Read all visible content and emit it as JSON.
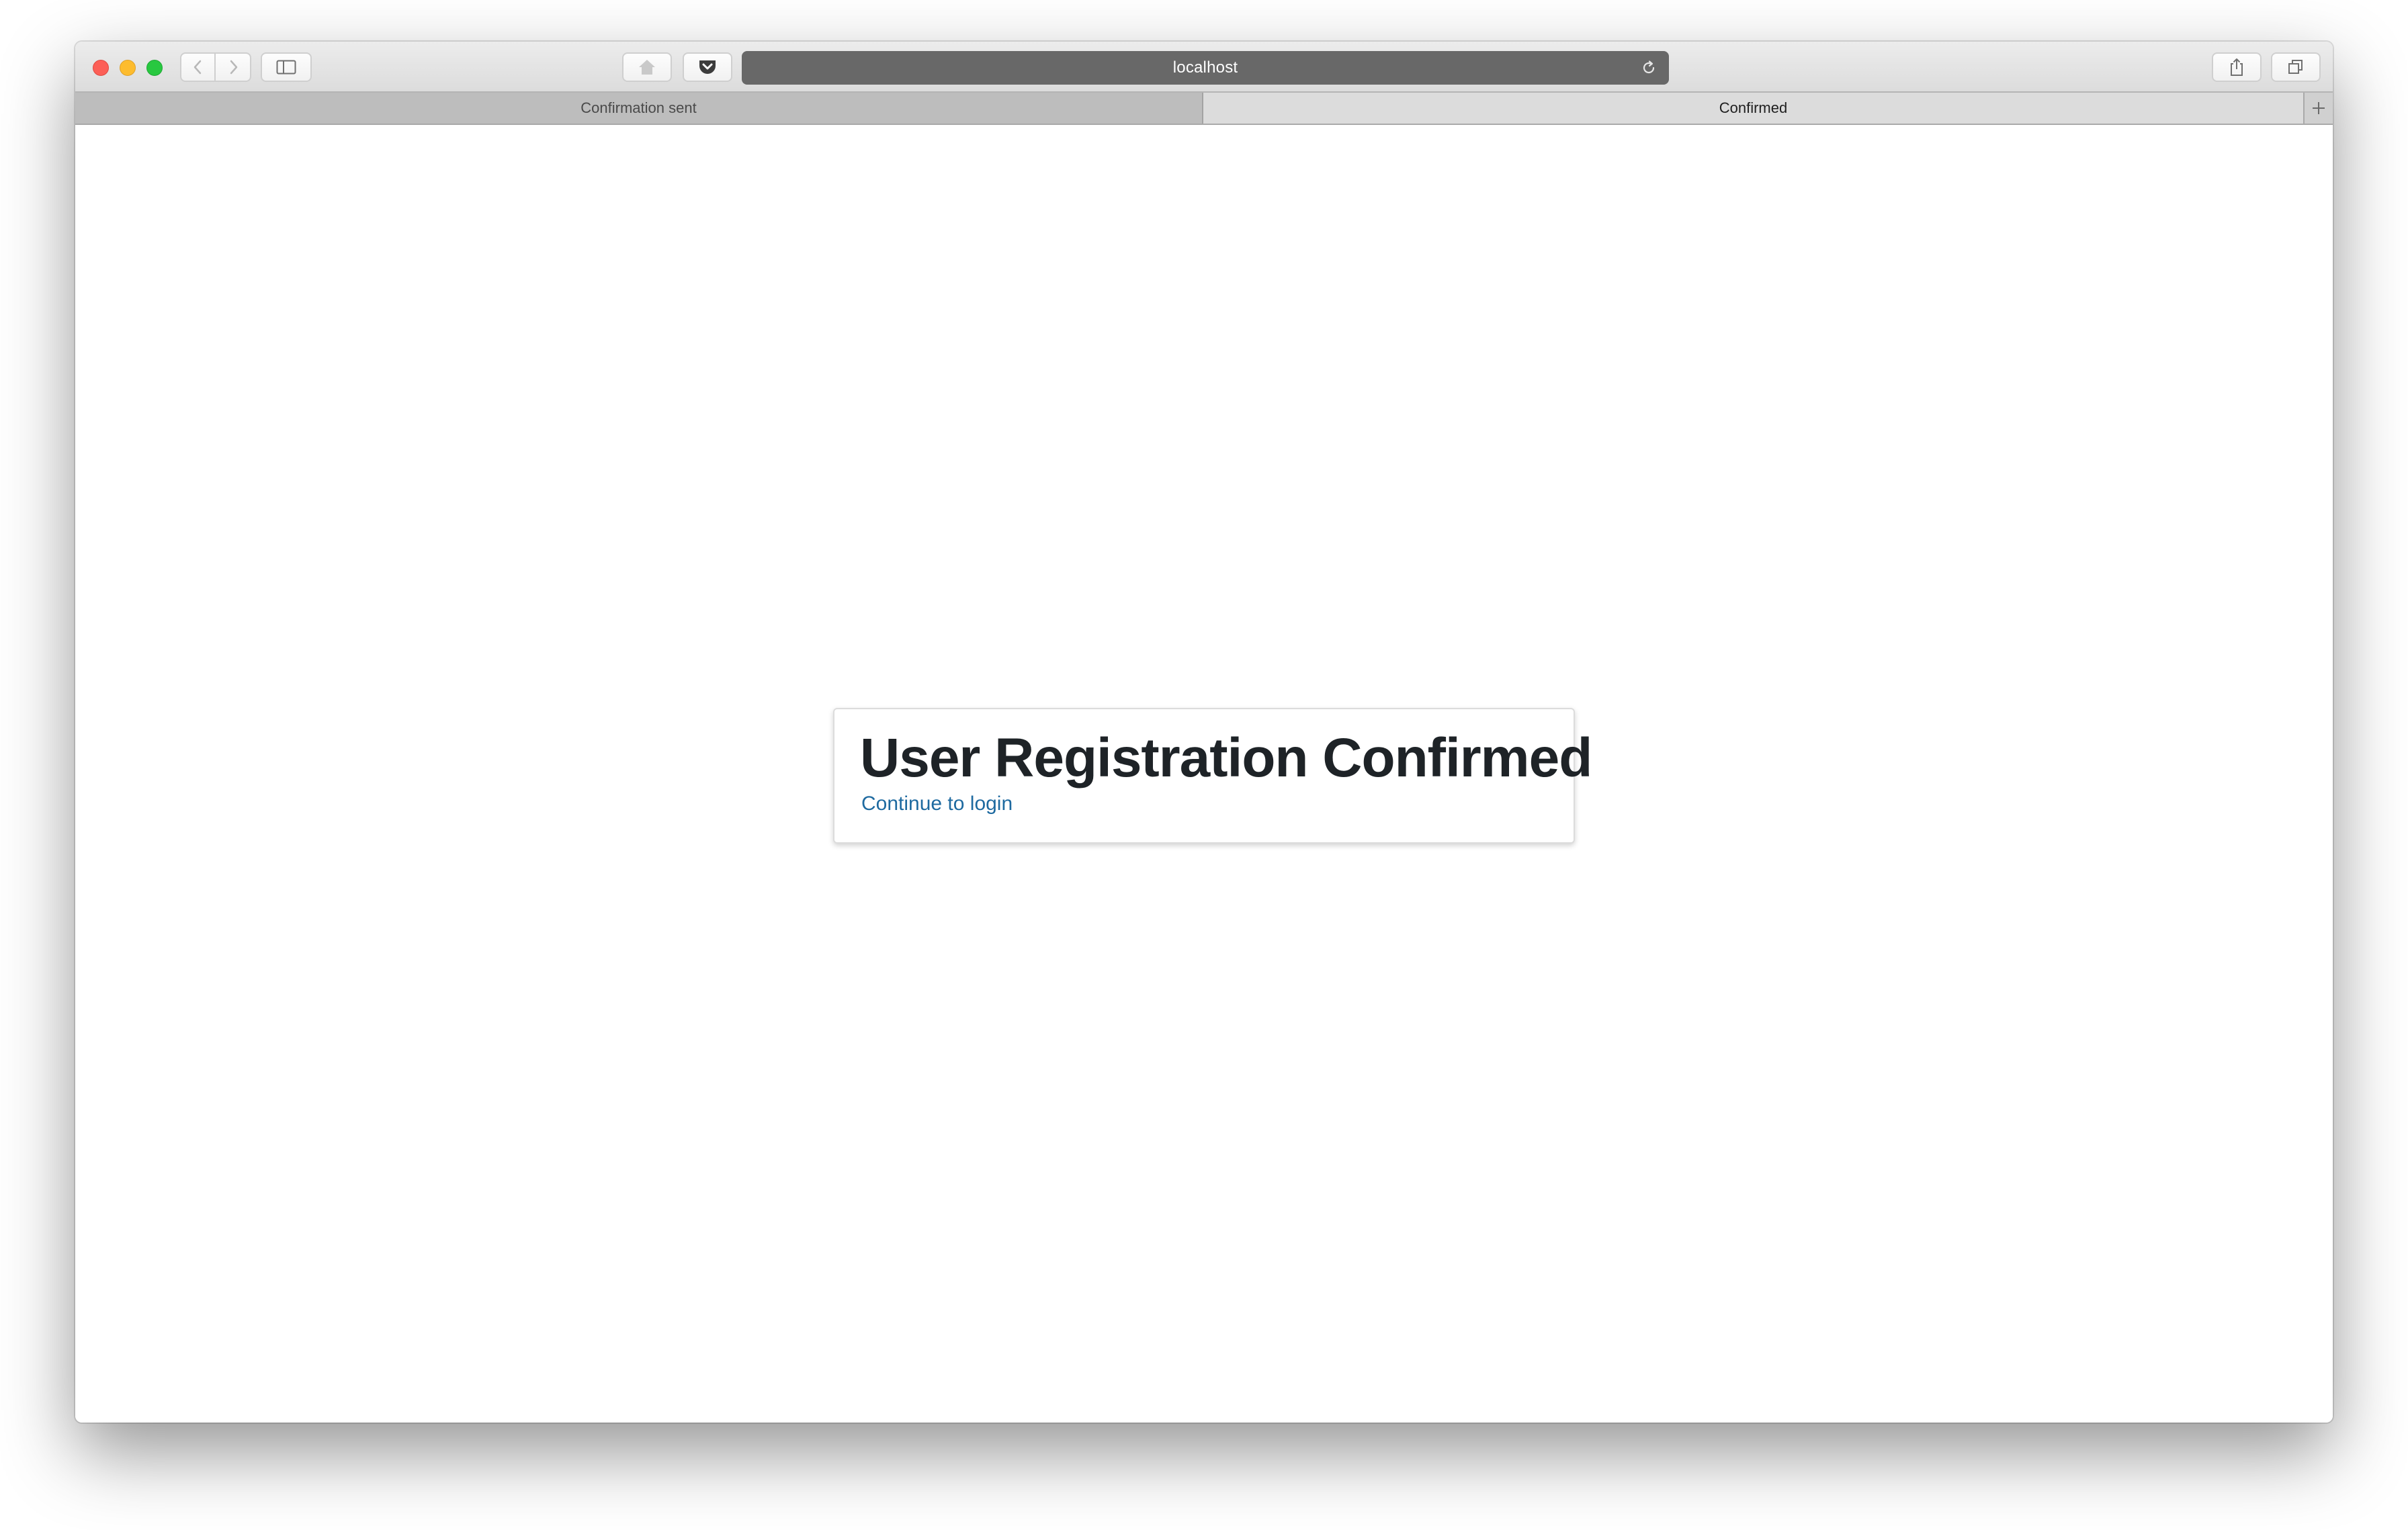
{
  "browser": {
    "address_bar": {
      "url": "localhost"
    },
    "tabs": [
      {
        "label": "Confirmation sent",
        "active": false
      },
      {
        "label": "Confirmed",
        "active": true
      }
    ],
    "icons": {
      "close": "close-window-icon",
      "minimize": "minimize-window-icon",
      "maximize": "maximize-window-icon",
      "back": "chevron-left-icon",
      "forward": "chevron-right-icon",
      "sidebar": "sidebar-icon",
      "home": "home-icon",
      "pocket": "pocket-icon",
      "reload": "reload-icon",
      "share": "share-icon",
      "tabs_overview": "tabs-overview-icon",
      "new_tab": "plus-icon"
    },
    "colors": {
      "address_bar_bg": "#686868",
      "traffic_red": "#fc5f57",
      "traffic_yellow": "#fdbc2e",
      "traffic_green": "#28c840"
    }
  },
  "page": {
    "heading": "User Registration Confirmed",
    "link_label": "Continue to login",
    "colors": {
      "heading": "#1e2327",
      "link": "#1e6aa0"
    }
  }
}
